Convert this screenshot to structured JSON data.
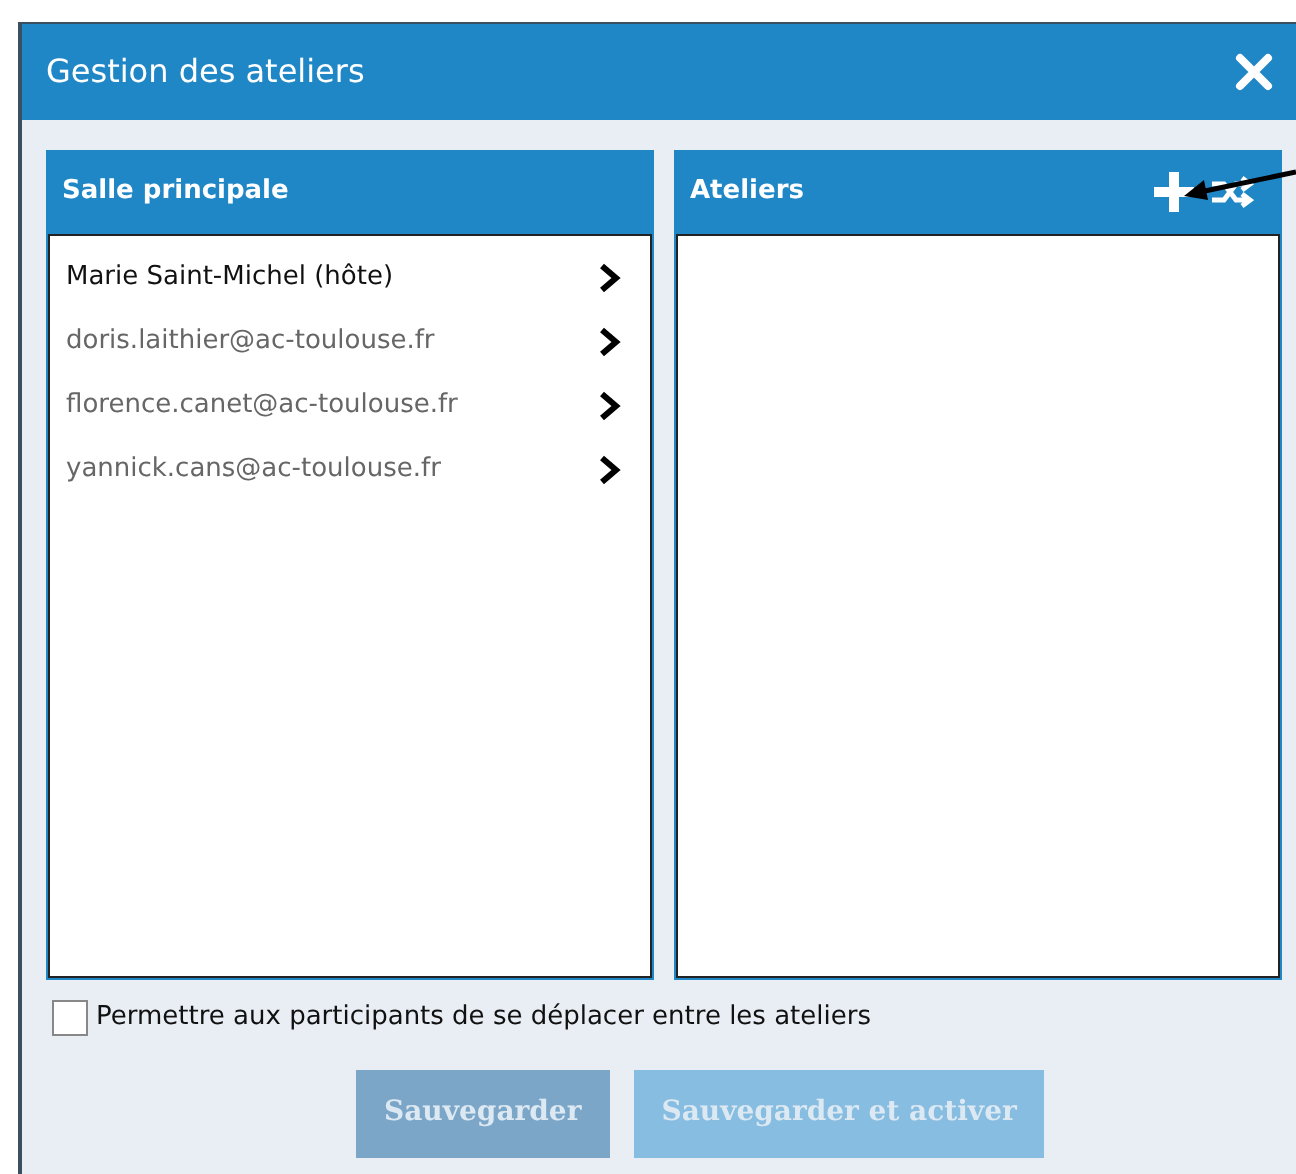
{
  "window": {
    "title": "Gestion des ateliers"
  },
  "main_room": {
    "title": "Salle principale",
    "participants": [
      {
        "name": "Marie Saint-Michel (hôte)",
        "host": true
      },
      {
        "name": "doris.laithier@ac-toulouse.fr",
        "host": false
      },
      {
        "name": "florence.canet@ac-toulouse.fr",
        "host": false
      },
      {
        "name": "yannick.cans@ac-toulouse.fr",
        "host": false
      }
    ]
  },
  "workshops": {
    "title": "Ateliers"
  },
  "allow_moving": {
    "label": "Permettre aux participants de se déplacer entre les ateliers",
    "checked": false
  },
  "buttons": [
    {
      "label": "Sauvegarder",
      "disabled": true,
      "kind": "save"
    },
    {
      "label": "Sauvegarder et activer",
      "disabled": true,
      "kind": "activate"
    }
  ]
}
